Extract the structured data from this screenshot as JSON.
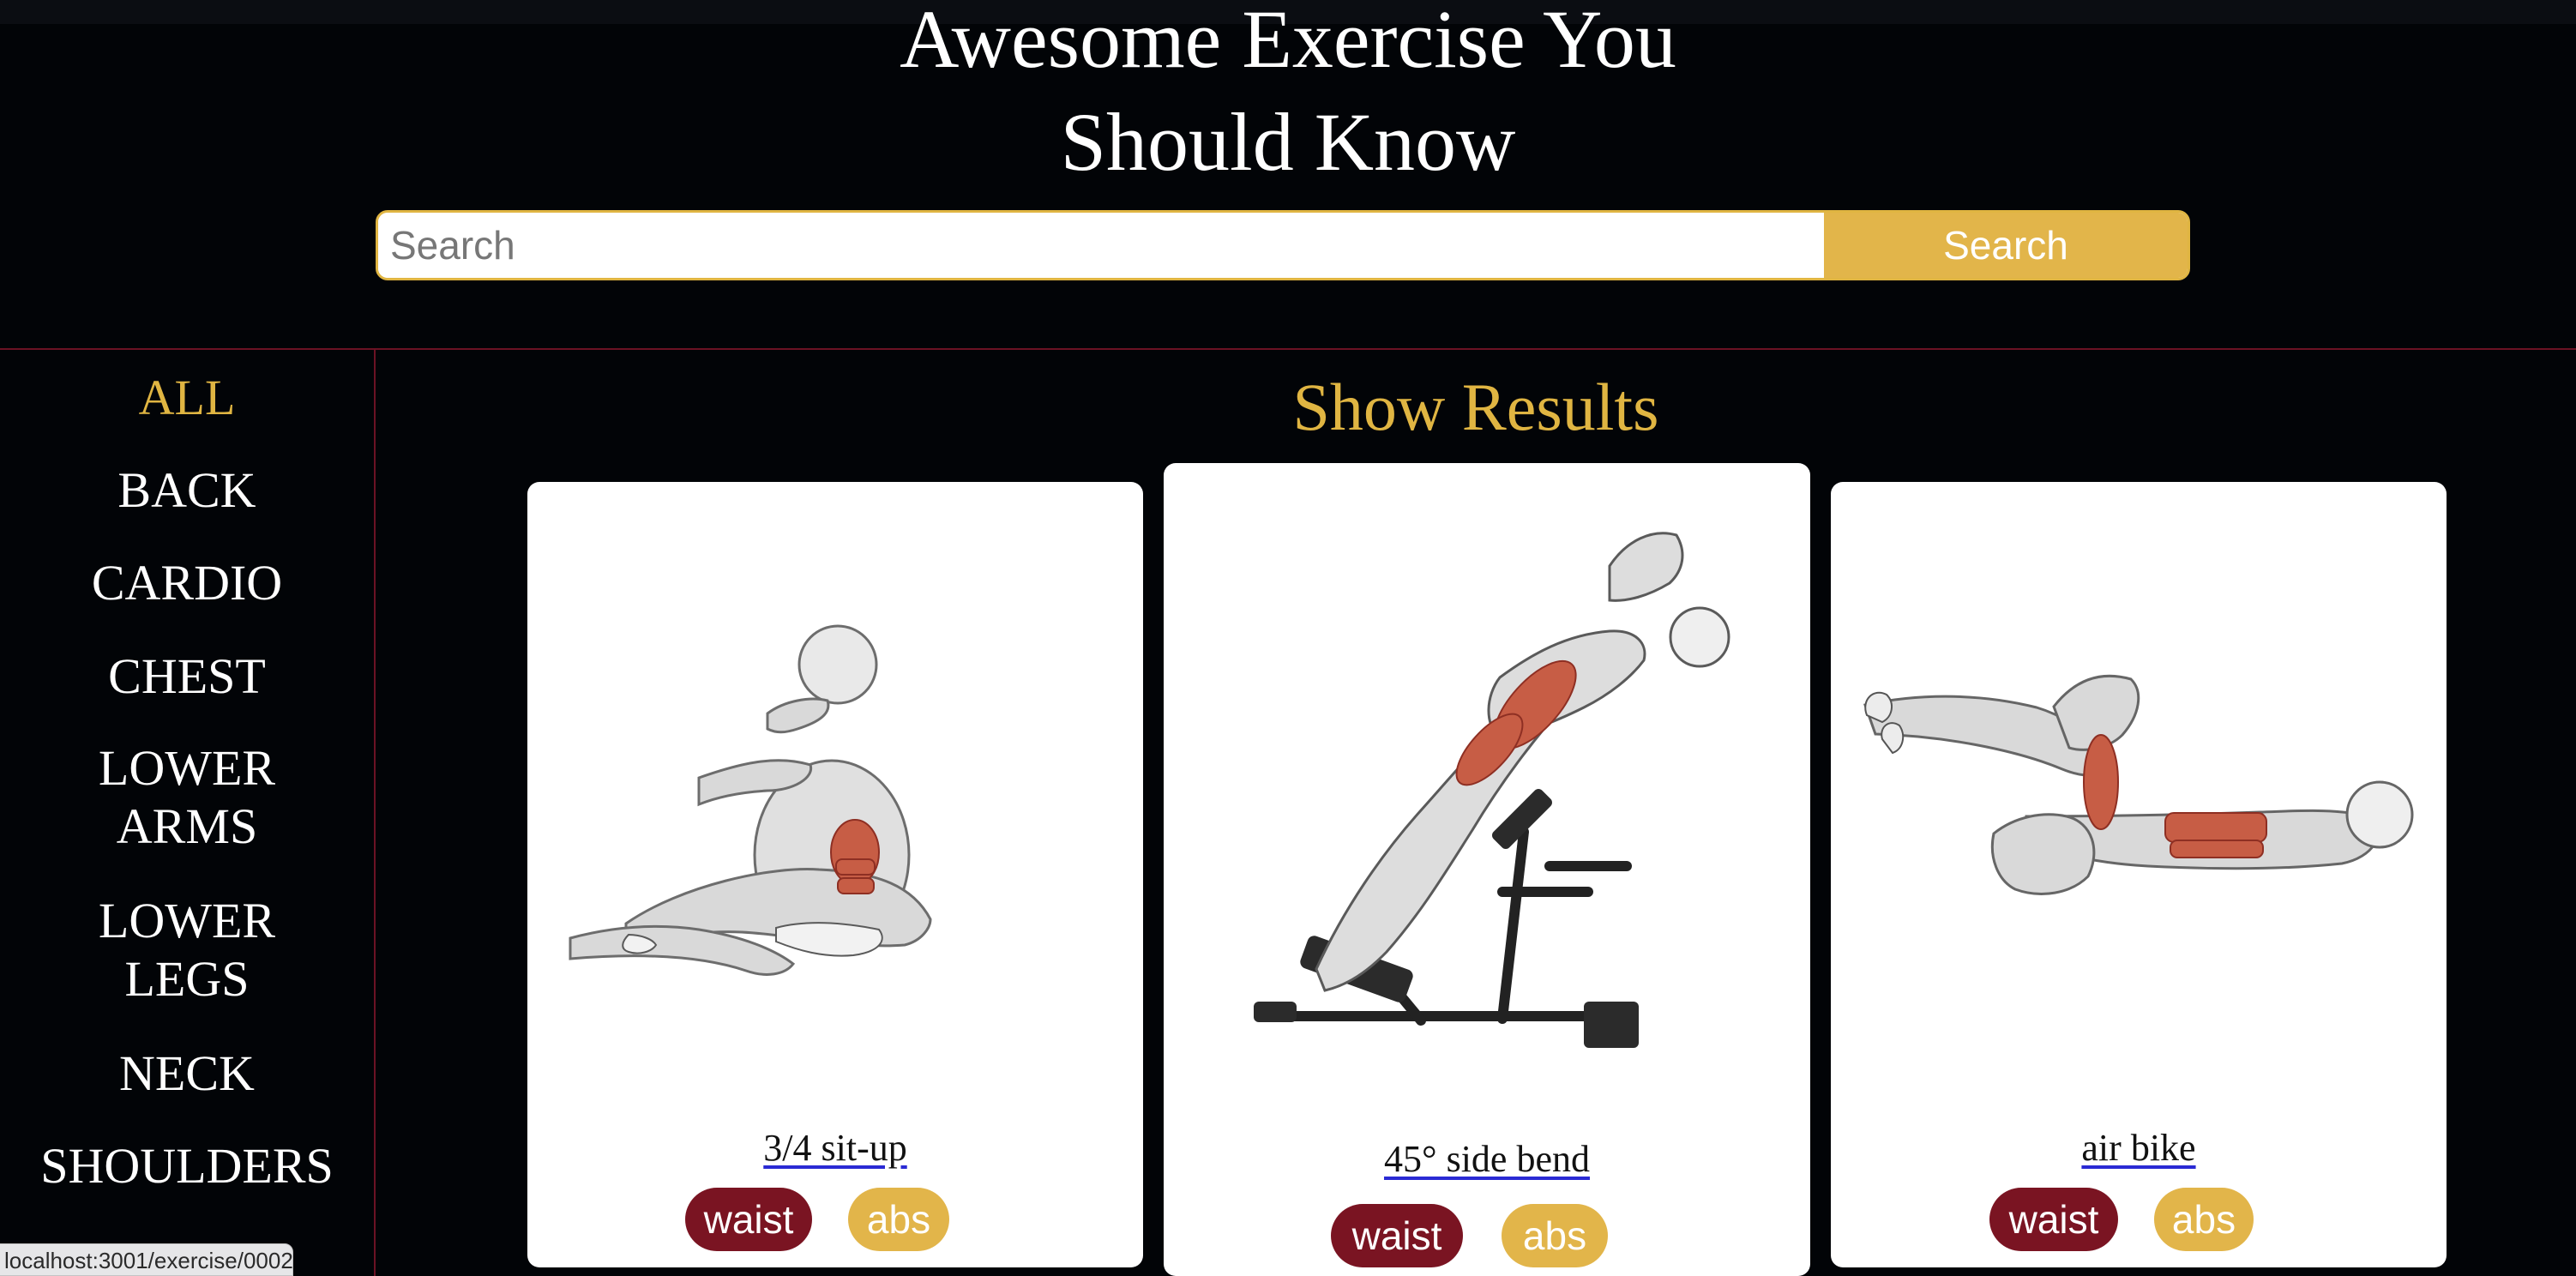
{
  "colors": {
    "background": "#020407",
    "accent": "#e0b542",
    "divider": "#6b1224",
    "body_part_pill": "#7a1422",
    "target_pill": "#e2b54a",
    "card_background": "#ffffff"
  },
  "hero": {
    "title_line_1": "Awesome Exercise You",
    "title_line_2": "Should Know"
  },
  "search": {
    "placeholder": "Search",
    "value": "",
    "button_label": "Search"
  },
  "sidebar": {
    "items": [
      {
        "label": "ALL",
        "active": true
      },
      {
        "label": "BACK",
        "active": false
      },
      {
        "label": "CARDIO",
        "active": false
      },
      {
        "label": "CHEST",
        "active": false
      },
      {
        "label": "LOWER\nARMS",
        "active": false
      },
      {
        "label": "LOWER\nLEGS",
        "active": false
      },
      {
        "label": "NECK",
        "active": false
      },
      {
        "label": "SHOULDERS",
        "active": false
      }
    ]
  },
  "results": {
    "heading": "Show Results",
    "cards": [
      {
        "name": "3/4 sit-up",
        "body_part": "waist",
        "target": "abs",
        "image_icon": "sit-up-illustration"
      },
      {
        "name": "45° side bend",
        "body_part": "waist",
        "target": "abs",
        "image_icon": "side-bend-illustration"
      },
      {
        "name": "air bike",
        "body_part": "waist",
        "target": "abs",
        "image_icon": "air-bike-illustration"
      }
    ]
  },
  "status_bar": {
    "url": "localhost:3001/exercise/0002"
  }
}
